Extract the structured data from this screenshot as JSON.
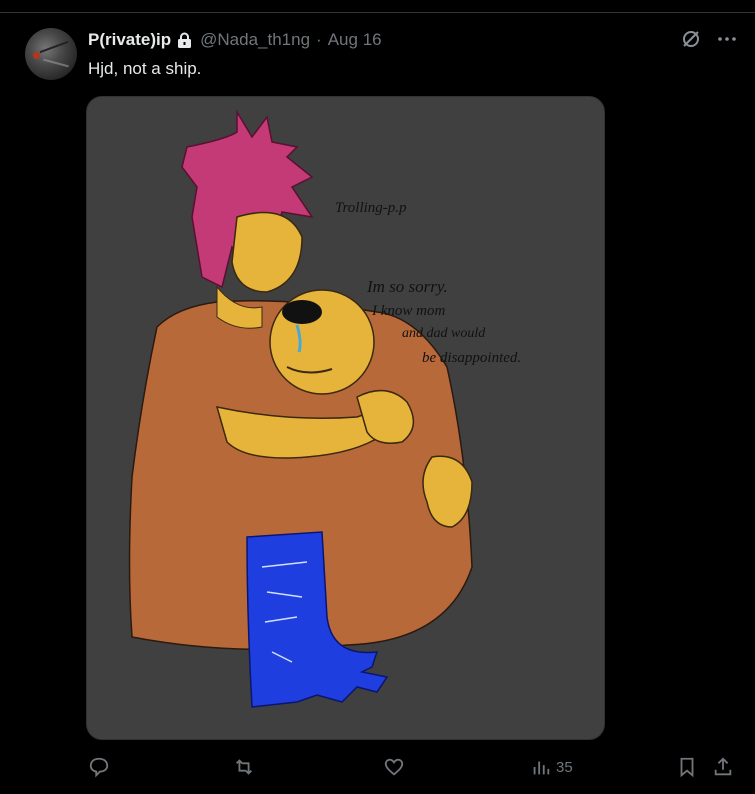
{
  "post": {
    "display_name": "P(rivate)ip",
    "handle": "@Nada_th1ng",
    "separator": "·",
    "date": "Aug 16",
    "text": "Hjd, not a ship.",
    "icons": {
      "lock": "lock-icon",
      "grok": "grok-icon",
      "more": "more-icon"
    },
    "media": {
      "background": "#404040",
      "annotations": [
        "Trolling-p.p",
        "Im so sorry.",
        "I know mom",
        "and dad would",
        "be disappointed."
      ]
    },
    "actions": {
      "reply": {
        "icon": "reply-icon",
        "count": ""
      },
      "repost": {
        "icon": "repost-icon",
        "count": ""
      },
      "like": {
        "icon": "heart-icon",
        "count": ""
      },
      "views": {
        "icon": "views-icon",
        "count": "35"
      },
      "bookmark": {
        "icon": "bookmark-icon"
      },
      "share": {
        "icon": "share-icon"
      }
    }
  },
  "colors": {
    "background": "#000000",
    "text": "#e7e9ea",
    "muted": "#71767b",
    "border": "#2f3336"
  }
}
